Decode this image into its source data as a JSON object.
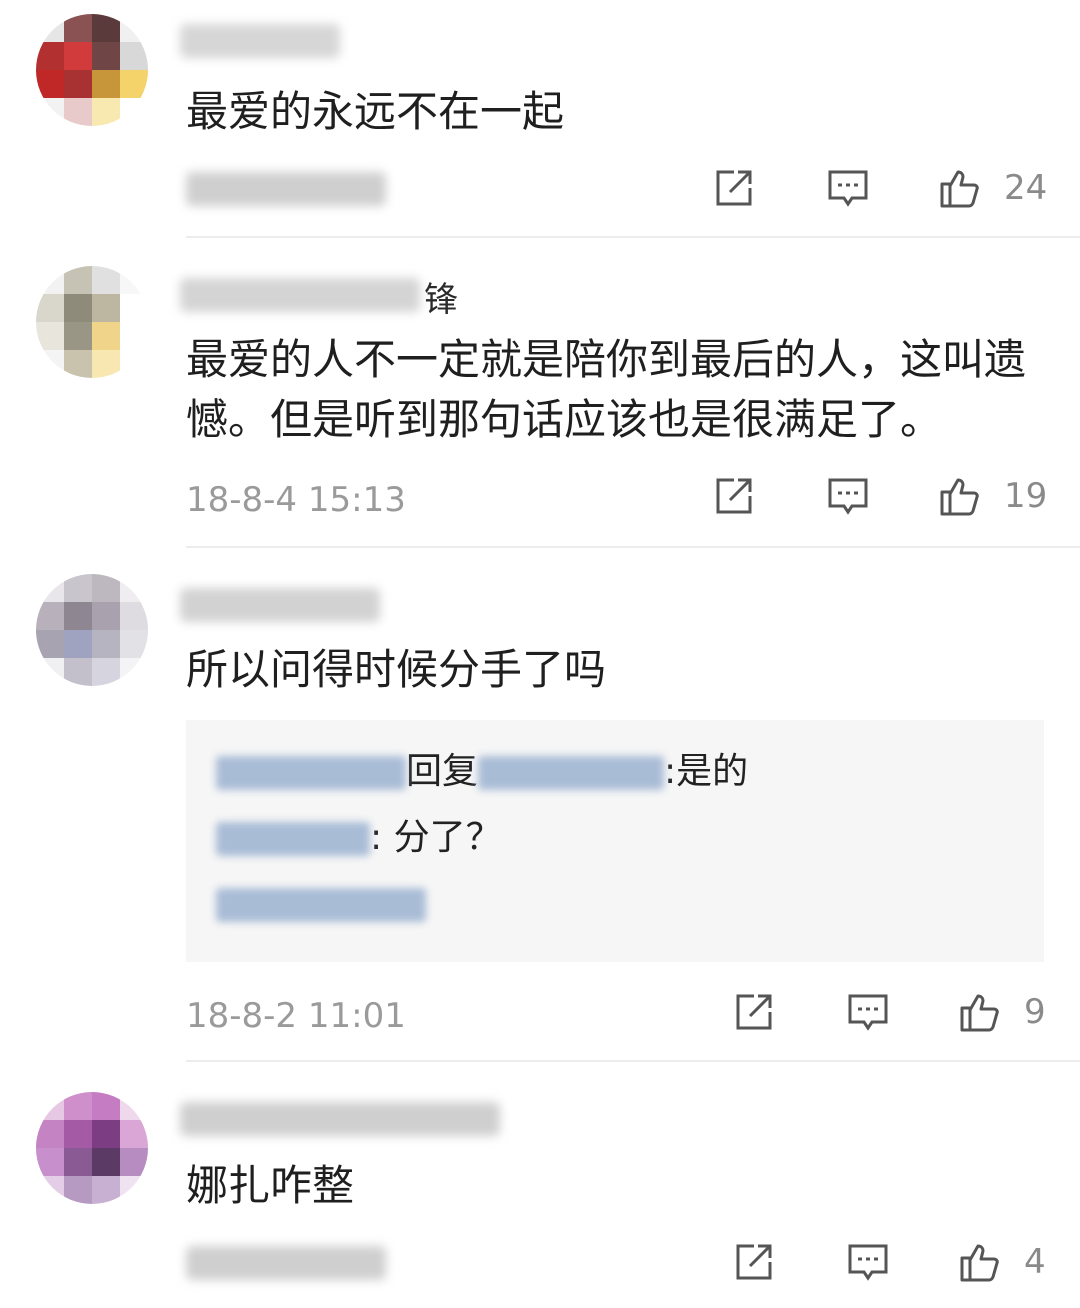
{
  "comments": [
    {
      "name_suffix": "",
      "text": "最爱的永远不在一起",
      "time": "",
      "likes": "24",
      "avatar_colors": [
        "#e6e6e6",
        "#8a5252",
        "#5a3a3a",
        "#f0f0f0",
        "#b33030",
        "#d23b3b",
        "#704545",
        "#d8d8d8",
        "#c02828",
        "#a83232",
        "#c8963a",
        "#f4d36a",
        "#f2f2f2",
        "#e8caca",
        "#f7e9b0",
        "#ffffff"
      ]
    },
    {
      "name_suffix": "锋",
      "text": "最爱的人不一定就是陪你到最后的人，这叫遗憾。但是听到那句话应该也是很满足了。",
      "time": "18-8-4 15:13",
      "likes": "19",
      "avatar_colors": [
        "#f2f2f2",
        "#c7c3b4",
        "#e0e0e0",
        "#f7f7f7",
        "#d9d7cc",
        "#8e8b7a",
        "#bdb7a2",
        "#ffffff",
        "#e8e6dc",
        "#9a9686",
        "#efd48a",
        "#ffffff",
        "#f4f4f4",
        "#c9c3ae",
        "#f8e7b0",
        "#ffffff"
      ]
    },
    {
      "name_suffix": "",
      "text": "所以问得时候分手了吗",
      "time": "18-8-2 11:01",
      "likes": "9",
      "avatar_colors": [
        "#e8e6ea",
        "#c9c5cc",
        "#bdb8c0",
        "#efedf0",
        "#b8b0ba",
        "#8e8690",
        "#a9a1ad",
        "#dedce0",
        "#a8a3b1",
        "#9fa3bf",
        "#b7b4c2",
        "#e2e1e6",
        "#f0eff2",
        "#c3c0cc",
        "#d6d4de",
        "#f4f3f6"
      ],
      "replies": [
        {
          "connector": "回复",
          "tail": ":是的"
        },
        {
          "tail": ": 分了？"
        }
      ]
    },
    {
      "name_suffix": "",
      "text": "娜扎咋整",
      "time": "",
      "likes": "4",
      "avatar_colors": [
        "#e7c8e4",
        "#cf8fcb",
        "#c67cc2",
        "#efd8ec",
        "#c483c2",
        "#a45aa5",
        "#7d3d83",
        "#d9a6d6",
        "#c78fcb",
        "#8a5a94",
        "#5c3a66",
        "#b78cc0",
        "#e4cde6",
        "#b79ac2",
        "#c7b0d2",
        "#efe3f1"
      ]
    }
  ]
}
